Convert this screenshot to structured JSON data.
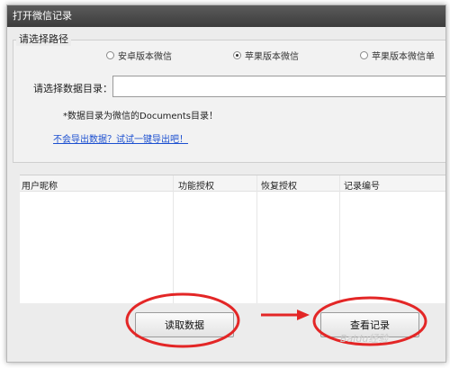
{
  "window": {
    "title": "打开微信记录"
  },
  "path_group": {
    "legend": "请选择路径",
    "options": [
      {
        "label": "安卓版本微信",
        "checked": false
      },
      {
        "label": "苹果版本微信",
        "checked": true
      },
      {
        "label": "苹果版本微信单",
        "checked": false
      }
    ]
  },
  "data_dir": {
    "label": "请选择数据目录：",
    "value": ""
  },
  "note": "*数据目录为微信的Documents目录！",
  "export_link": "不会导出数据？试试一键导出吧！",
  "table": {
    "columns": [
      "用户昵称",
      "功能授权",
      "恢复授权",
      "记录编号"
    ],
    "rows": []
  },
  "buttons": {
    "read": "读取数据",
    "view": "查看记录"
  },
  "annotation": {
    "color": "#e32626"
  },
  "watermark": "Baidu经验"
}
